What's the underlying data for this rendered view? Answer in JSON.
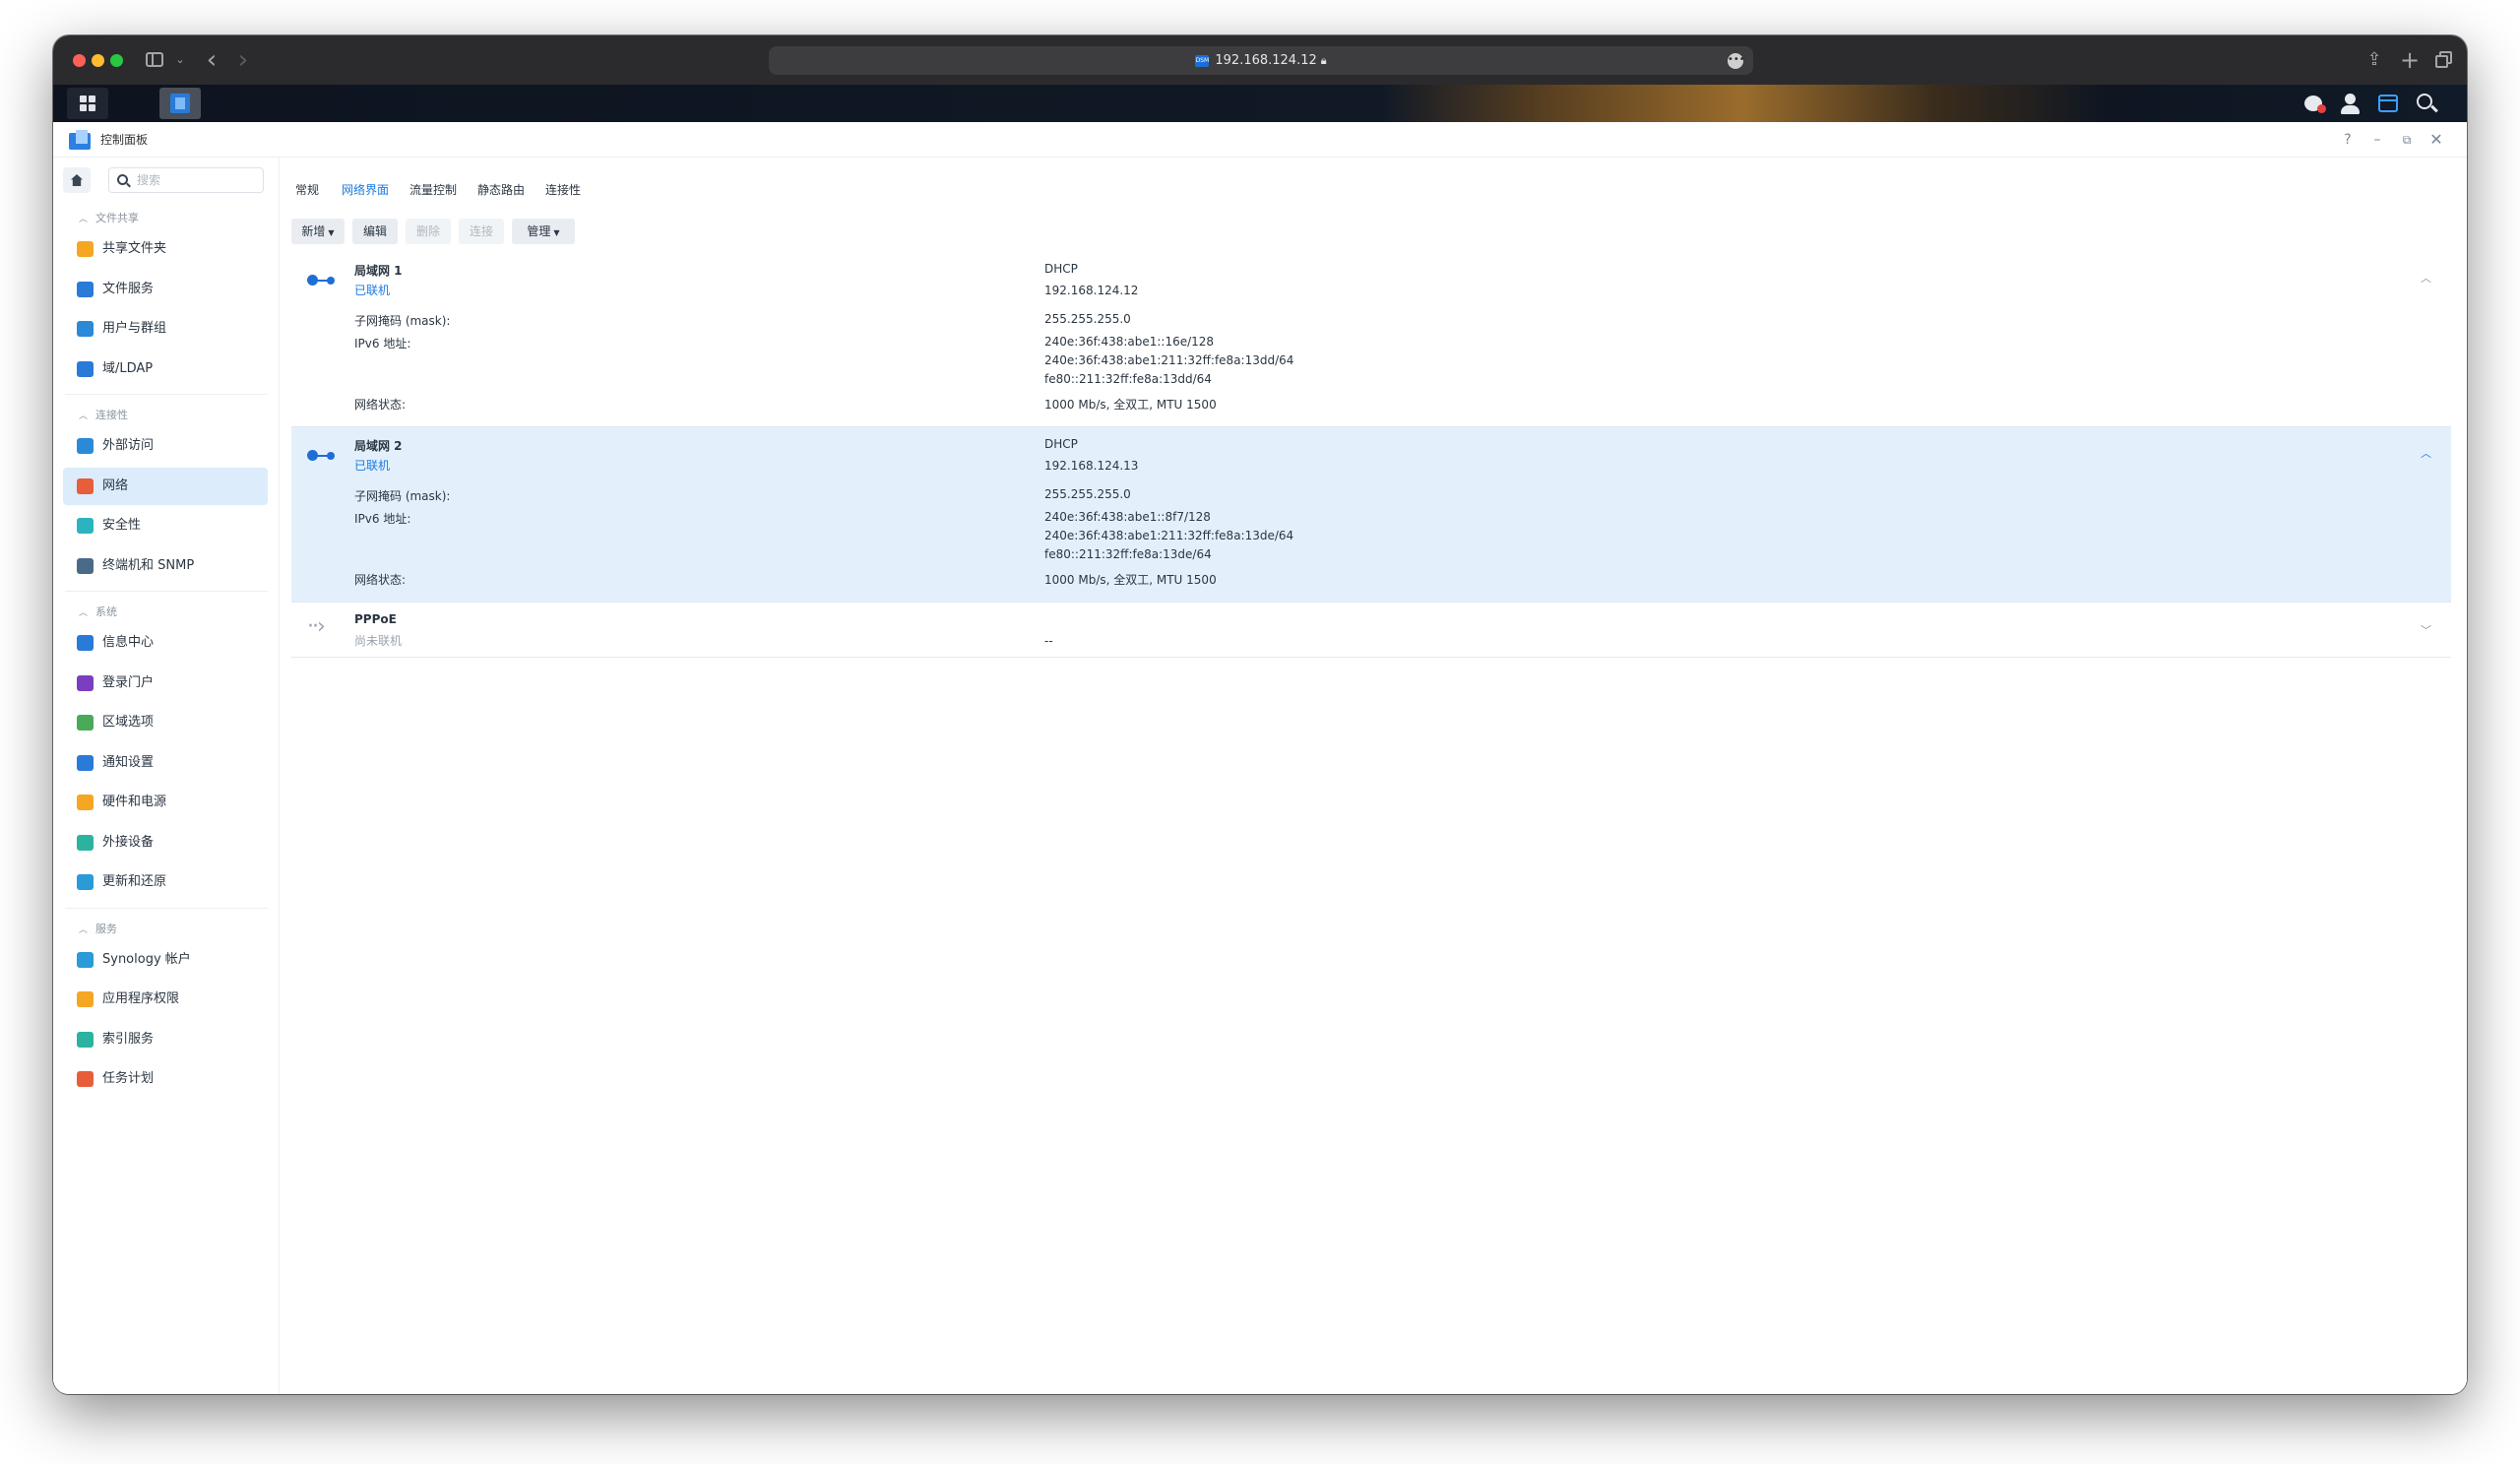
{
  "browser": {
    "url": "192.168.124.12",
    "favicon_text": "DSM"
  },
  "app": {
    "title": "控制面板",
    "controls": {
      "help": "?",
      "minimize": "–",
      "maximize": "⧉",
      "close": "✕"
    }
  },
  "nav": {
    "search_placeholder": "搜索",
    "sections": [
      {
        "label": "文件共享",
        "items": [
          {
            "label": "共享文件夹",
            "icon": "folder-icon",
            "color": "#f5a623"
          },
          {
            "label": "文件服务",
            "icon": "file-services-icon",
            "color": "#2a7ad8"
          },
          {
            "label": "用户与群组",
            "icon": "users-icon",
            "color": "#2a8ad8"
          },
          {
            "label": "域/LDAP",
            "icon": "ldap-icon",
            "color": "#2a7ad8"
          }
        ]
      },
      {
        "label": "连接性",
        "items": [
          {
            "label": "外部访问",
            "icon": "external-access-icon",
            "color": "#2a8ad8"
          },
          {
            "label": "网络",
            "icon": "network-house-icon",
            "color": "#e85d3a",
            "active": true
          },
          {
            "label": "安全性",
            "icon": "shield-icon",
            "color": "#2bb3c0"
          },
          {
            "label": "终端机和 SNMP",
            "icon": "terminal-icon",
            "color": "#4a6a8a"
          }
        ]
      },
      {
        "label": "系统",
        "items": [
          {
            "label": "信息中心",
            "icon": "info-icon",
            "color": "#2a7ad8"
          },
          {
            "label": "登录门户",
            "icon": "login-portal-icon",
            "color": "#7a3fc0"
          },
          {
            "label": "区域选项",
            "icon": "regional-icon",
            "color": "#4aaa5a"
          },
          {
            "label": "通知设置",
            "icon": "notification-icon",
            "color": "#2a7ad8"
          },
          {
            "label": "硬件和电源",
            "icon": "bulb-icon",
            "color": "#f5a623"
          },
          {
            "label": "外接设备",
            "icon": "external-device-icon",
            "color": "#2bb3a0"
          },
          {
            "label": "更新和还原",
            "icon": "update-icon",
            "color": "#2a9ad8"
          }
        ]
      },
      {
        "label": "服务",
        "items": [
          {
            "label": "Synology 帐户",
            "icon": "synology-account-icon",
            "color": "#2a9ad8"
          },
          {
            "label": "应用程序权限",
            "icon": "lock-icon",
            "color": "#f5a623"
          },
          {
            "label": "索引服务",
            "icon": "index-icon",
            "color": "#2bb3a0"
          },
          {
            "label": "任务计划",
            "icon": "calendar-icon",
            "color": "#e85d3a"
          }
        ]
      }
    ]
  },
  "tabs": [
    "常规",
    "网络界面",
    "流量控制",
    "静态路由",
    "连接性"
  ],
  "active_tab": "网络界面",
  "toolbar": {
    "create": "新增",
    "edit": "编辑",
    "delete": "删除",
    "connect": "连接",
    "manage": "管理"
  },
  "labels": {
    "subnet_mask": "子网掩码 (mask):",
    "ipv6": "IPv6 地址:",
    "net_status": "网络状态:"
  },
  "interfaces": [
    {
      "name": "局域网 1",
      "status": "已联机",
      "mode": "DHCP",
      "ip": "192.168.124.12",
      "mask": "255.255.255.0",
      "ipv6": [
        "240e:36f:438:abe1::16e/128",
        "240e:36f:438:abe1:211:32ff:fe8a:13dd/64",
        "fe80::211:32ff:fe8a:13dd/64"
      ],
      "net_status": "1000 Mb/s, 全双工, MTU 1500",
      "expanded": true
    },
    {
      "name": "局域网 2",
      "status": "已联机",
      "mode": "DHCP",
      "ip": "192.168.124.13",
      "mask": "255.255.255.0",
      "ipv6": [
        "240e:36f:438:abe1::8f7/128",
        "240e:36f:438:abe1:211:32ff:fe8a:13de/64",
        "fe80::211:32ff:fe8a:13de/64"
      ],
      "net_status": "1000 Mb/s, 全双工, MTU 1500",
      "expanded": true,
      "selected": true
    },
    {
      "name": "PPPoE",
      "status": "尚未联机",
      "value": "--",
      "expanded": false
    }
  ]
}
